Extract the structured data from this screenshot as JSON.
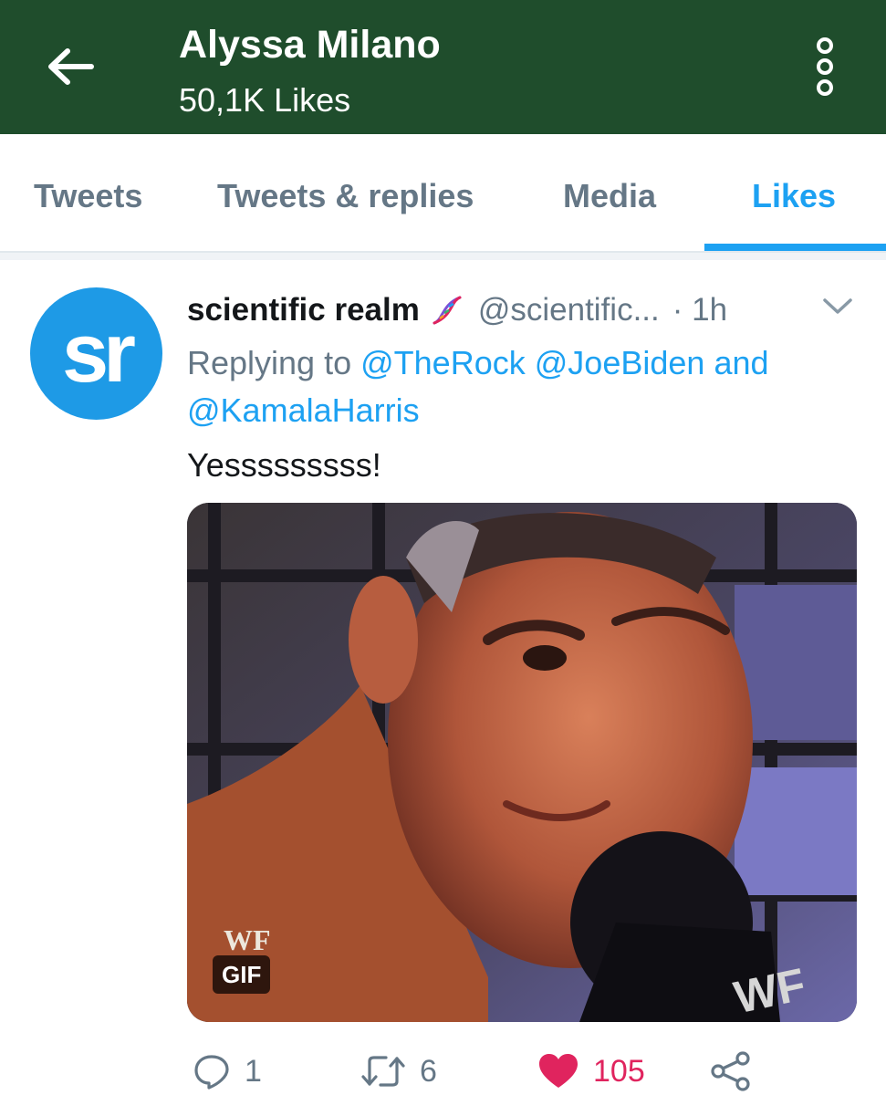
{
  "header": {
    "title": "Alyssa Milano",
    "subtitle": "50,1K Likes",
    "back_icon": "arrow-left-icon",
    "more_icon": "vertical-dots-icon",
    "background": "#1f4d2c"
  },
  "tabs": [
    {
      "label": "Tweets",
      "active": false
    },
    {
      "label": "Tweets & replies",
      "active": false
    },
    {
      "label": "Media",
      "active": false
    },
    {
      "label": "Likes",
      "active": true
    }
  ],
  "tweet": {
    "avatar_text": "sr",
    "avatar_color": "#1e9ae6",
    "display_name": "scientific realm",
    "name_emoji": "dna-icon",
    "handle": "@scientific...",
    "time": "· 1h",
    "reply_prefix": "Replying to",
    "mention_1": "@TheRock",
    "mention_2": "@JoeBiden",
    "reply_and": "and",
    "mention_3": "@KamalaHarris",
    "text": "Yesssssssss!",
    "media_badge": "GIF",
    "actions": {
      "reply_count": "1",
      "retweet_count": "6",
      "like_count": "105",
      "liked": true
    }
  },
  "colors": {
    "accent": "#1da1f2",
    "secondary_text": "#657786",
    "like": "#e0245e"
  }
}
